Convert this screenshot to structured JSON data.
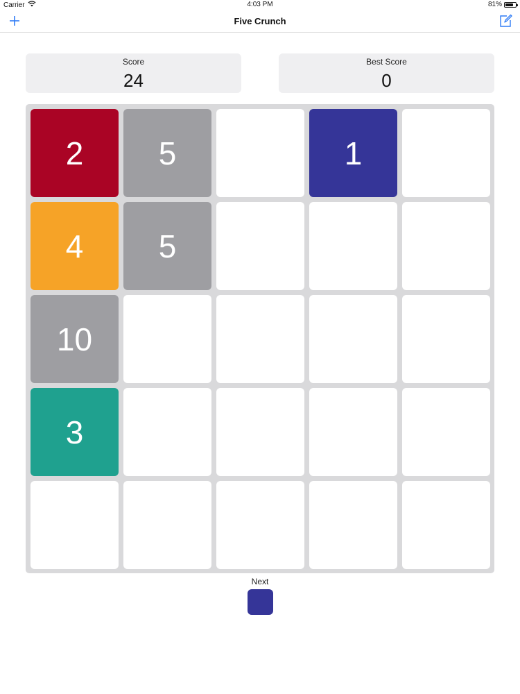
{
  "status_bar": {
    "carrier": "Carrier",
    "time": "4:03 PM",
    "battery": "81%",
    "battery_level": 0.81
  },
  "nav": {
    "title": "Five Crunch",
    "add_icon": "plus-icon",
    "edit_icon": "compose-icon",
    "accent_color": "#2f7cf6"
  },
  "scores": {
    "score_label": "Score",
    "score_value": "24",
    "best_label": "Best Score",
    "best_value": "0"
  },
  "board": {
    "rows": 5,
    "cols": 5,
    "tiles": [
      [
        "2",
        "5",
        "",
        "1",
        ""
      ],
      [
        "4",
        "5",
        "",
        "",
        ""
      ],
      [
        "10",
        "",
        "",
        "",
        ""
      ],
      [
        "3",
        "",
        "",
        "",
        ""
      ],
      [
        "",
        "",
        "",
        "",
        ""
      ]
    ],
    "tile_colors": {
      "1": "#353598",
      "2": "#aa0425",
      "3": "#1fa18f",
      "4": "#f6a327",
      "5": "#9e9ea2",
      "10": "#9e9ea2",
      "empty": "#ffffff"
    }
  },
  "next": {
    "label": "Next",
    "tile_color": "#353598"
  }
}
